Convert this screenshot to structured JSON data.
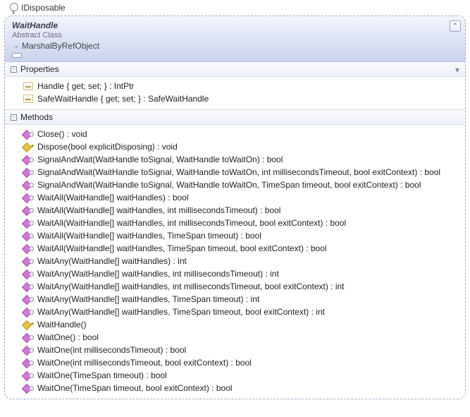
{
  "interface_name": "IDisposable",
  "class_name": "WaitHandle",
  "class_kind": "Abstract Class",
  "inherits": "MarshalByRefObject",
  "sections": {
    "properties_label": "Properties",
    "methods_label": "Methods"
  },
  "properties": [
    "Handle { get; set; } : IntPtr",
    "SafeWaitHandle { get; set; } : SafeWaitHandle"
  ],
  "methods": [
    {
      "sig": "Close() : void",
      "access": "public"
    },
    {
      "sig": "Dispose(bool explicitDisposing) : void",
      "access": "protected"
    },
    {
      "sig": "SignalAndWait(WaitHandle toSignal, WaitHandle toWaitOn) : bool",
      "access": "public"
    },
    {
      "sig": "SignalAndWait(WaitHandle toSignal, WaitHandle toWaitOn, int millisecondsTimeout, bool exitContext) : bool",
      "access": "public"
    },
    {
      "sig": "SignalAndWait(WaitHandle toSignal, WaitHandle toWaitOn, TimeSpan timeout, bool exitContext) : bool",
      "access": "public"
    },
    {
      "sig": "WaitAll(WaitHandle[] waitHandles) : bool",
      "access": "public"
    },
    {
      "sig": "WaitAll(WaitHandle[] waitHandles, int millisecondsTimeout) : bool",
      "access": "public"
    },
    {
      "sig": "WaitAll(WaitHandle[] waitHandles, int millisecondsTimeout, bool exitContext) : bool",
      "access": "public"
    },
    {
      "sig": "WaitAll(WaitHandle[] waitHandles, TimeSpan timeout) : bool",
      "access": "public"
    },
    {
      "sig": "WaitAll(WaitHandle[] waitHandles, TimeSpan timeout, bool exitContext) : bool",
      "access": "public"
    },
    {
      "sig": "WaitAny(WaitHandle[] waitHandles) : int",
      "access": "public"
    },
    {
      "sig": "WaitAny(WaitHandle[] waitHandles, int millisecondsTimeout) : int",
      "access": "public"
    },
    {
      "sig": "WaitAny(WaitHandle[] waitHandles, int millisecondsTimeout, bool exitContext) : int",
      "access": "public"
    },
    {
      "sig": "WaitAny(WaitHandle[] waitHandles, TimeSpan timeout) : int",
      "access": "public"
    },
    {
      "sig": "WaitAny(WaitHandle[] waitHandles, TimeSpan timeout, bool exitContext) : int",
      "access": "public"
    },
    {
      "sig": "WaitHandle()",
      "access": "protected"
    },
    {
      "sig": "WaitOne() : bool",
      "access": "public"
    },
    {
      "sig": "WaitOne(int millisecondsTimeout) : bool",
      "access": "public"
    },
    {
      "sig": "WaitOne(int millisecondsTimeout, bool exitContext) : bool",
      "access": "public"
    },
    {
      "sig": "WaitOne(TimeSpan timeout) : bool",
      "access": "public"
    },
    {
      "sig": "WaitOne(TimeSpan timeout, bool exitContext) : bool",
      "access": "public"
    }
  ]
}
